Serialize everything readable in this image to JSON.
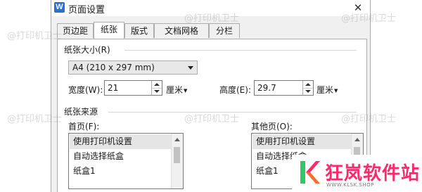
{
  "window": {
    "app_icon_letter": "W",
    "title": "页面设置",
    "close_glyph": "✕"
  },
  "tabs": [
    {
      "label": "页边距",
      "active": false
    },
    {
      "label": "纸张",
      "active": true
    },
    {
      "label": "版式",
      "active": false
    },
    {
      "label": "文档网格",
      "active": false
    },
    {
      "label": "分栏",
      "active": false
    }
  ],
  "paper_size": {
    "section_title": "纸张大小(R)",
    "selected": "A4 (210 x 297 mm)",
    "width_label": "宽度(W):",
    "width_value": "21",
    "width_unit": "厘米",
    "height_label": "高度(E):",
    "height_value": "29.7",
    "height_unit": "厘米"
  },
  "paper_source": {
    "section_title": "纸张来源",
    "first_page_label": "首页(F):",
    "first_page_items": [
      "使用打印机设置",
      "自动选择纸盒",
      "纸盒1"
    ],
    "other_pages_label": "其他页(O):",
    "other_pages_items": [
      "使用打印机设置",
      "自动选择纸盒",
      "纸盒1"
    ]
  },
  "watermark_text": "@打印机卫士",
  "logo": {
    "name": "狂岚软件站",
    "url": "WWW.KLSK.SHOP",
    "colors": {
      "primary": "#ff2a6a",
      "accent": "#35c46a"
    }
  },
  "colors": {
    "dialog_bg": "#f0f0f0",
    "panel_bg": "#ffffff",
    "selection": "#e5e5e5",
    "app_icon": "#2b6fd6"
  }
}
